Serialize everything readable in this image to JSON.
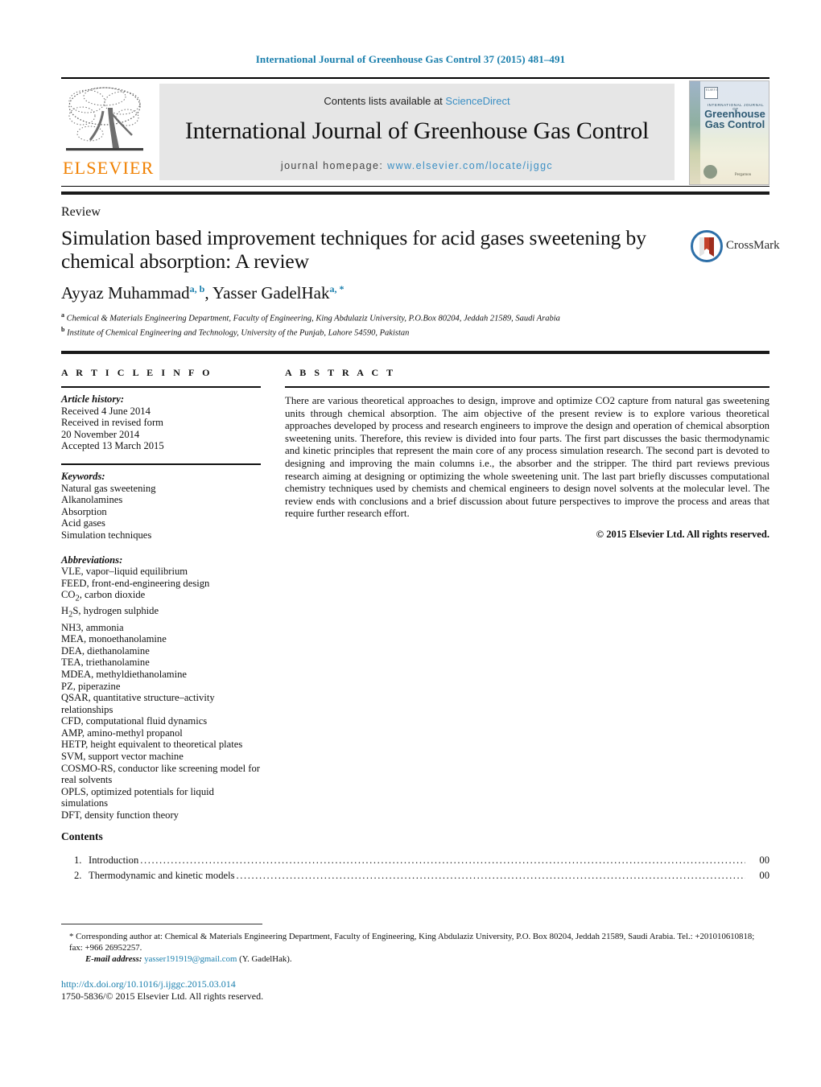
{
  "running_head": "International Journal of Greenhouse Gas Control 37 (2015) 481–491",
  "masthead": {
    "publisher_name": "ELSEVIER",
    "publisher_logo_icon": "elsevier-tree-logo",
    "contents_prefix": "Contents lists available at ",
    "contents_link": "ScienceDirect",
    "journal_title": "International Journal of Greenhouse Gas Control",
    "homepage_prefix": "journal homepage: ",
    "homepage_url": "www.elsevier.com/locate/ijggc",
    "cover": {
      "supertitle": "INTERNATIONAL JOURNAL OF",
      "title_line1": "Greenhouse",
      "title_line2": "Gas Control",
      "publisher_mark": "ELSEVIER",
      "imprint": "Pergamon"
    }
  },
  "article": {
    "type": "Review",
    "title": "Simulation based improvement techniques for acid gases sweetening by chemical absorption: A review",
    "crossmark_label": "CrossMark",
    "authors_plain": "Ayyaz Muhammad",
    "author1": "Ayyaz Muhammad",
    "author1_marks": "a, b",
    "author2": "Yasser GadelHak",
    "author2_marks": "a, *",
    "affiliations": [
      {
        "mark": "a",
        "text": "Chemical & Materials Engineering Department, Faculty of Engineering, King Abdulaziz University, P.O.Box 80204, Jeddah 21589, Saudi Arabia"
      },
      {
        "mark": "b",
        "text": "Institute of Chemical Engineering and Technology, University of the Punjab, Lahore 54590, Pakistan"
      }
    ]
  },
  "article_info": {
    "heading": "A R T I C L E    I N F O",
    "history_label": "Article history:",
    "history": [
      "Received 4 June 2014",
      "Received in revised form",
      "20 November 2014",
      "Accepted 13 March 2015"
    ],
    "keywords_label": "Keywords:",
    "keywords": [
      "Natural gas sweetening",
      "Alkanolamines",
      "Absorption",
      "Acid gases",
      "Simulation techniques"
    ],
    "abbreviations_label": "Abbreviations:",
    "abbreviations": [
      "VLE, vapor–liquid equilibrium",
      "FEED, front-end-engineering design",
      "CO2, carbon dioxide",
      "H2S, hydrogen sulphide",
      "NH3, ammonia",
      "MEA, monoethanolamine",
      "DEA, diethanolamine",
      "TEA, triethanolamine",
      "MDEA, methyldiethanolamine",
      "PZ, piperazine",
      "QSAR, quantitative structure–activity relationships",
      "CFD, computational fluid dynamics",
      "AMP, amino-methyl propanol",
      "HETP, height equivalent to theoretical plates",
      "SVM, support vector machine",
      "COSMO-RS, conductor like screening model for real solvents",
      "OPLS, optimized potentials for liquid simulations",
      "DFT, density function theory"
    ]
  },
  "abstract": {
    "heading": "A B S T R A C T",
    "text": "There are various theoretical approaches to design, improve and optimize CO2 capture from natural gas sweetening units through chemical absorption. The aim objective of the present review is to explore various theoretical approaches developed by process and research engineers to improve the design and operation of chemical absorption sweetening units. Therefore, this review is divided into four parts. The first part discusses the basic thermodynamic and kinetic principles that represent the main core of any process simulation research. The second part is devoted to designing and improving the main columns i.e., the absorber and the stripper. The third part reviews previous research aiming at designing or optimizing the whole sweetening unit. The last part briefly discusses computational chemistry techniques used by chemists and chemical engineers to design novel solvents at the molecular level. The review ends with conclusions and a brief discussion about future perspectives to improve the process and areas that require further research effort.",
    "copyright": "© 2015 Elsevier Ltd. All rights reserved."
  },
  "contents": {
    "heading": "Contents",
    "entries": [
      {
        "number": "1.",
        "label": "Introduction",
        "page": "00"
      },
      {
        "number": "2.",
        "label": "Thermodynamic and kinetic models",
        "page": "00"
      }
    ]
  },
  "footer": {
    "corresponding_note": "* Corresponding author at: Chemical & Materials Engineering Department, Faculty of Engineering, King Abdulaziz University, P.O. Box 80204, Jeddah 21589, Saudi Arabia. Tel.: +201010610818; fax: +966 26952257.",
    "email_label": "E-mail address:",
    "email": "yasser191919@gmail.com",
    "email_owner": "(Y. GadelHak).",
    "doi": "http://dx.doi.org/10.1016/j.ijggc.2015.03.014",
    "issn_line": "1750-5836/© 2015 Elsevier Ltd. All rights reserved."
  },
  "colors": {
    "link_blue": "#1a7fad",
    "sciencedirect_blue": "#3b8fc4",
    "elsevier_orange": "#f08000",
    "band_gray": "#e6e6e6"
  }
}
